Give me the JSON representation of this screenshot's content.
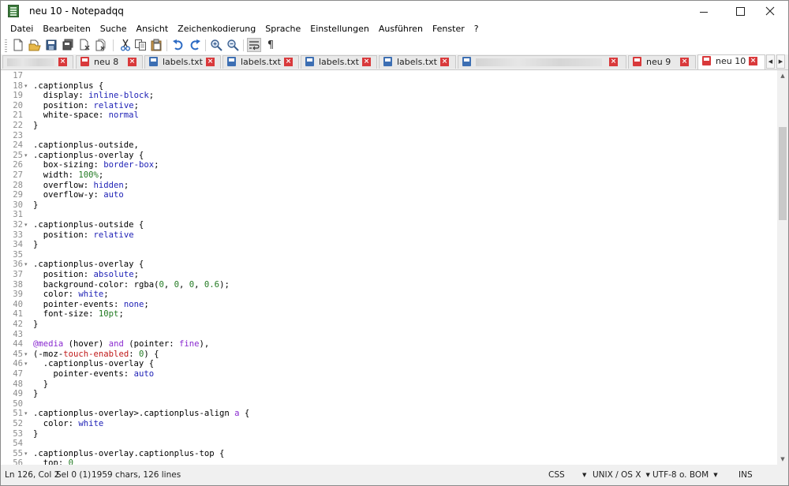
{
  "window": {
    "title": "neu 10 - Notepadqq"
  },
  "menu": [
    "Datei",
    "Bearbeiten",
    "Suche",
    "Ansicht",
    "Zeichenkodierung",
    "Sprache",
    "Einstellungen",
    "Ausführen",
    "Fenster",
    "?"
  ],
  "toolbar": [
    "new-file",
    "open-file",
    "save",
    "save-all",
    "close",
    "close-all",
    "undo",
    "redo",
    "cut",
    "copy",
    "paste",
    "zoom-in",
    "zoom-out",
    "word-wrap",
    "show-whitespace"
  ],
  "tabs": [
    {
      "label": "",
      "icon": "none",
      "blurred": true,
      "active": false
    },
    {
      "label": "neu 8",
      "icon": "red",
      "blurred": false,
      "active": false
    },
    {
      "label": "labels.txt",
      "icon": "blue",
      "blurred": false,
      "active": false
    },
    {
      "label": "labels.txt",
      "icon": "blue",
      "blurred": false,
      "active": false
    },
    {
      "label": "labels.txt",
      "icon": "blue",
      "blurred": false,
      "active": false
    },
    {
      "label": "labels.txt",
      "icon": "blue",
      "blurred": false,
      "active": false
    },
    {
      "label": "",
      "icon": "blue",
      "blurred": true,
      "active": false
    },
    {
      "label": "neu 9",
      "icon": "red",
      "blurred": false,
      "active": false
    },
    {
      "label": "neu 10",
      "icon": "red",
      "blurred": false,
      "active": true
    }
  ],
  "editor": {
    "lines": [
      {
        "n": "17",
        "fold": false,
        "segs": []
      },
      {
        "n": "18",
        "fold": true,
        "segs": [
          [
            ".captionplus {",
            "k"
          ]
        ]
      },
      {
        "n": "19",
        "fold": false,
        "segs": [
          [
            "  display: ",
            "k"
          ],
          [
            "inline-block",
            "v"
          ],
          [
            ";",
            "k"
          ]
        ]
      },
      {
        "n": "20",
        "fold": false,
        "segs": [
          [
            "  position: ",
            "k"
          ],
          [
            "relative",
            "v"
          ],
          [
            ";",
            "k"
          ]
        ]
      },
      {
        "n": "21",
        "fold": false,
        "segs": [
          [
            "  white-space: ",
            "k"
          ],
          [
            "normal",
            "v"
          ]
        ]
      },
      {
        "n": "22",
        "fold": false,
        "segs": [
          [
            "}",
            "k"
          ]
        ]
      },
      {
        "n": "23",
        "fold": false,
        "segs": []
      },
      {
        "n": "24",
        "fold": false,
        "segs": [
          [
            ".captionplus-outside,",
            "k"
          ]
        ]
      },
      {
        "n": "25",
        "fold": true,
        "segs": [
          [
            ".captionplus-overlay {",
            "k"
          ]
        ]
      },
      {
        "n": "26",
        "fold": false,
        "segs": [
          [
            "  box-sizing: ",
            "k"
          ],
          [
            "border-box",
            "v"
          ],
          [
            ";",
            "k"
          ]
        ]
      },
      {
        "n": "27",
        "fold": false,
        "segs": [
          [
            "  width: ",
            "k"
          ],
          [
            "100%",
            "n"
          ],
          [
            ";",
            "k"
          ]
        ]
      },
      {
        "n": "28",
        "fold": false,
        "segs": [
          [
            "  overflow: ",
            "k"
          ],
          [
            "hidden",
            "v"
          ],
          [
            ";",
            "k"
          ]
        ]
      },
      {
        "n": "29",
        "fold": false,
        "segs": [
          [
            "  overflow-y: ",
            "k"
          ],
          [
            "auto",
            "v"
          ]
        ]
      },
      {
        "n": "30",
        "fold": false,
        "segs": [
          [
            "}",
            "k"
          ]
        ]
      },
      {
        "n": "31",
        "fold": false,
        "segs": []
      },
      {
        "n": "32",
        "fold": true,
        "segs": [
          [
            ".captionplus-outside {",
            "k"
          ]
        ]
      },
      {
        "n": "33",
        "fold": false,
        "segs": [
          [
            "  position: ",
            "k"
          ],
          [
            "relative",
            "v"
          ]
        ]
      },
      {
        "n": "34",
        "fold": false,
        "segs": [
          [
            "}",
            "k"
          ]
        ]
      },
      {
        "n": "35",
        "fold": false,
        "segs": []
      },
      {
        "n": "36",
        "fold": true,
        "segs": [
          [
            ".captionplus-overlay {",
            "k"
          ]
        ]
      },
      {
        "n": "37",
        "fold": false,
        "segs": [
          [
            "  position: ",
            "k"
          ],
          [
            "absolute",
            "v"
          ],
          [
            ";",
            "k"
          ]
        ]
      },
      {
        "n": "38",
        "fold": false,
        "segs": [
          [
            "  background-color: ",
            "k"
          ],
          [
            "rgba(",
            "k"
          ],
          [
            "0",
            "n"
          ],
          [
            ", ",
            "k"
          ],
          [
            "0",
            "n"
          ],
          [
            ", ",
            "k"
          ],
          [
            "0",
            "n"
          ],
          [
            ", ",
            "k"
          ],
          [
            "0.6",
            "n"
          ],
          [
            ");",
            "k"
          ]
        ]
      },
      {
        "n": "39",
        "fold": false,
        "segs": [
          [
            "  color: ",
            "k"
          ],
          [
            "white",
            "v"
          ],
          [
            ";",
            "k"
          ]
        ]
      },
      {
        "n": "40",
        "fold": false,
        "segs": [
          [
            "  pointer-events: ",
            "k"
          ],
          [
            "none",
            "v"
          ],
          [
            ";",
            "k"
          ]
        ]
      },
      {
        "n": "41",
        "fold": false,
        "segs": [
          [
            "  font-size: ",
            "k"
          ],
          [
            "10pt",
            "n"
          ],
          [
            ";",
            "k"
          ]
        ]
      },
      {
        "n": "42",
        "fold": false,
        "segs": [
          [
            "}",
            "k"
          ]
        ]
      },
      {
        "n": "43",
        "fold": false,
        "segs": []
      },
      {
        "n": "44",
        "fold": false,
        "segs": [
          [
            "@media",
            "at"
          ],
          [
            " (hover) ",
            "k"
          ],
          [
            "and",
            "at"
          ],
          [
            " (pointer: ",
            "k"
          ],
          [
            "fine",
            "at"
          ],
          [
            "),",
            "k"
          ]
        ]
      },
      {
        "n": "45",
        "fold": true,
        "segs": [
          [
            "(-moz-",
            "k"
          ],
          [
            "touch-enabled",
            "r"
          ],
          [
            ": ",
            "k"
          ],
          [
            "0",
            "n"
          ],
          [
            ") {",
            "k"
          ]
        ]
      },
      {
        "n": "46",
        "fold": true,
        "segs": [
          [
            "  .captionplus-overlay {",
            "k"
          ]
        ]
      },
      {
        "n": "47",
        "fold": false,
        "segs": [
          [
            "    pointer-events: ",
            "k"
          ],
          [
            "auto",
            "v"
          ]
        ]
      },
      {
        "n": "48",
        "fold": false,
        "segs": [
          [
            "  }",
            "k"
          ]
        ]
      },
      {
        "n": "49",
        "fold": false,
        "segs": [
          [
            "}",
            "k"
          ]
        ]
      },
      {
        "n": "50",
        "fold": false,
        "segs": []
      },
      {
        "n": "51",
        "fold": true,
        "segs": [
          [
            ".captionplus-overlay>.captionplus-align ",
            "k"
          ],
          [
            "a",
            "at"
          ],
          [
            " {",
            "k"
          ]
        ]
      },
      {
        "n": "52",
        "fold": false,
        "segs": [
          [
            "  color: ",
            "k"
          ],
          [
            "white",
            "v"
          ]
        ]
      },
      {
        "n": "53",
        "fold": false,
        "segs": [
          [
            "}",
            "k"
          ]
        ]
      },
      {
        "n": "54",
        "fold": false,
        "segs": []
      },
      {
        "n": "55",
        "fold": true,
        "segs": [
          [
            ".captionplus-overlay.captionplus-top {",
            "k"
          ]
        ]
      },
      {
        "n": "56",
        "fold": false,
        "segs": [
          [
            "  top: ",
            "k"
          ],
          [
            "0",
            "n"
          ]
        ]
      }
    ]
  },
  "status": {
    "position": "Ln 126, Col 2",
    "selection": "Sel 0 (1)",
    "stats": "1959 chars, 126 lines",
    "language": "CSS",
    "eol": "UNIX / OS X",
    "encoding": "UTF-8 o. BOM",
    "mode": "INS"
  }
}
